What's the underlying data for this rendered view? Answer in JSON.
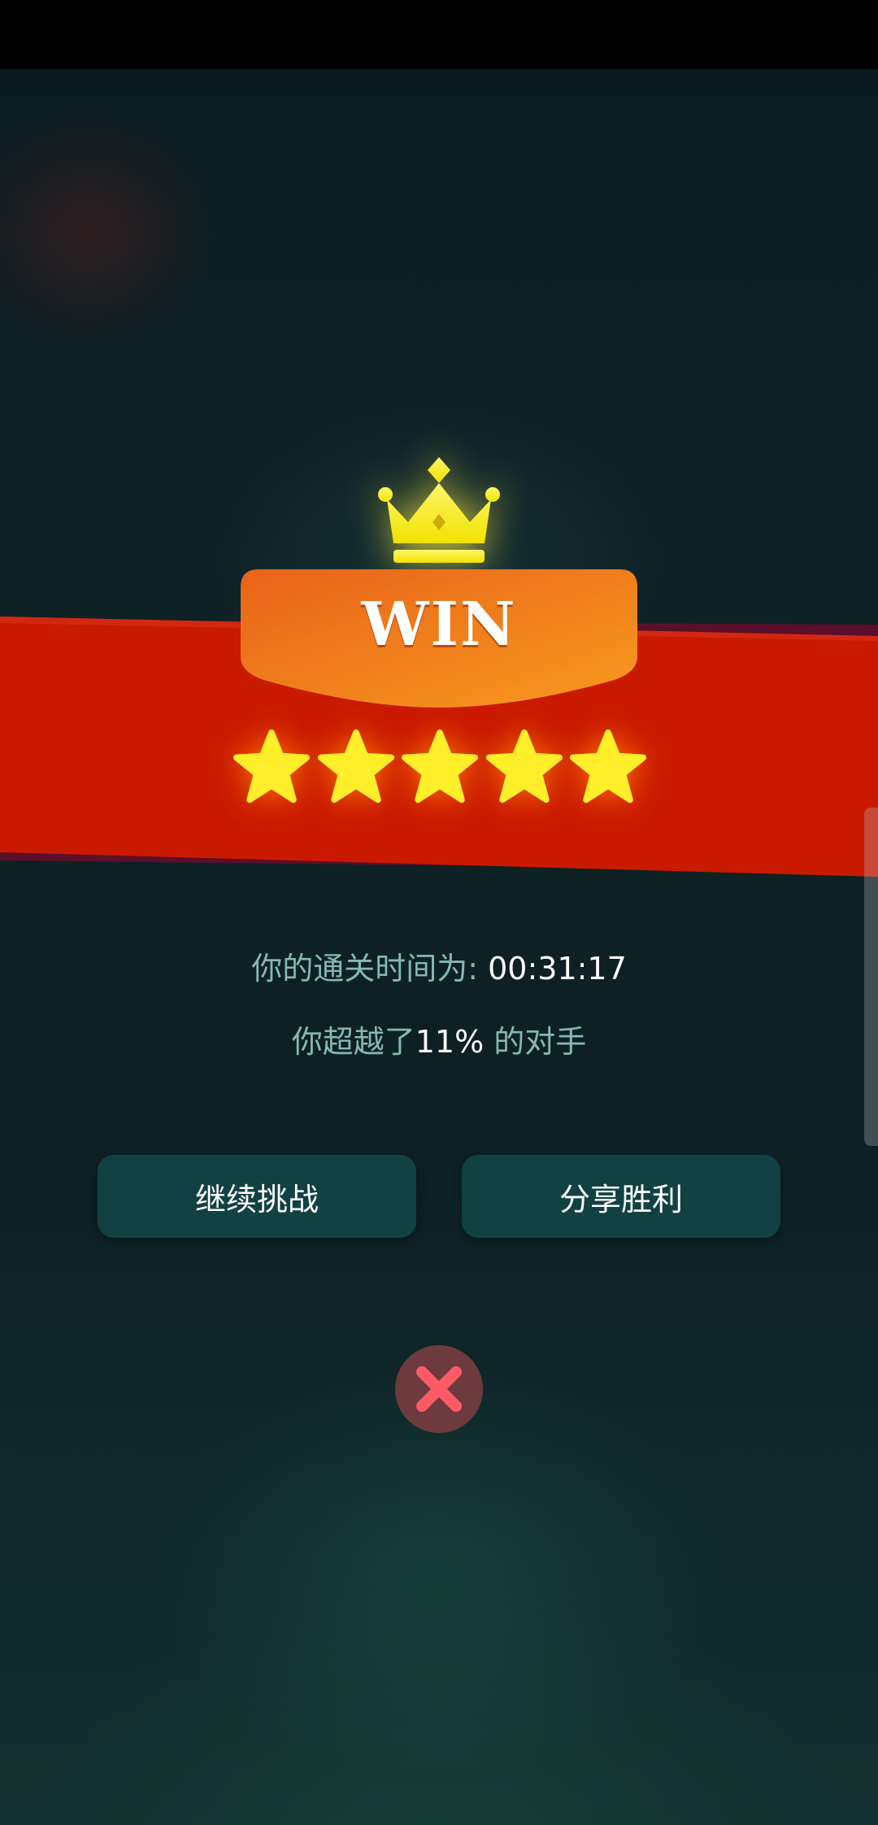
{
  "banner": {
    "title": "WIN",
    "star_rating": 5,
    "star_max": 5
  },
  "result": {
    "time_label": "你的通关时间为:",
    "time_value": "00:31:17",
    "surpass_prefix": "你超越了",
    "surpass_value": "11%",
    "surpass_suffix": "的对手"
  },
  "buttons": {
    "continue_label": "继续挑战",
    "share_label": "分享胜利"
  },
  "icons": {
    "crown": "crown-icon",
    "star": "star-icon",
    "close": "close-icon"
  },
  "colors": {
    "crown": "#f7ec1c",
    "ribbon": "#c91a00",
    "banner": "#f07a1a",
    "star": "#ffef2a",
    "button_bg": "#114143",
    "close_bg": "#6d3a3e",
    "close_x": "#ff5a66"
  }
}
